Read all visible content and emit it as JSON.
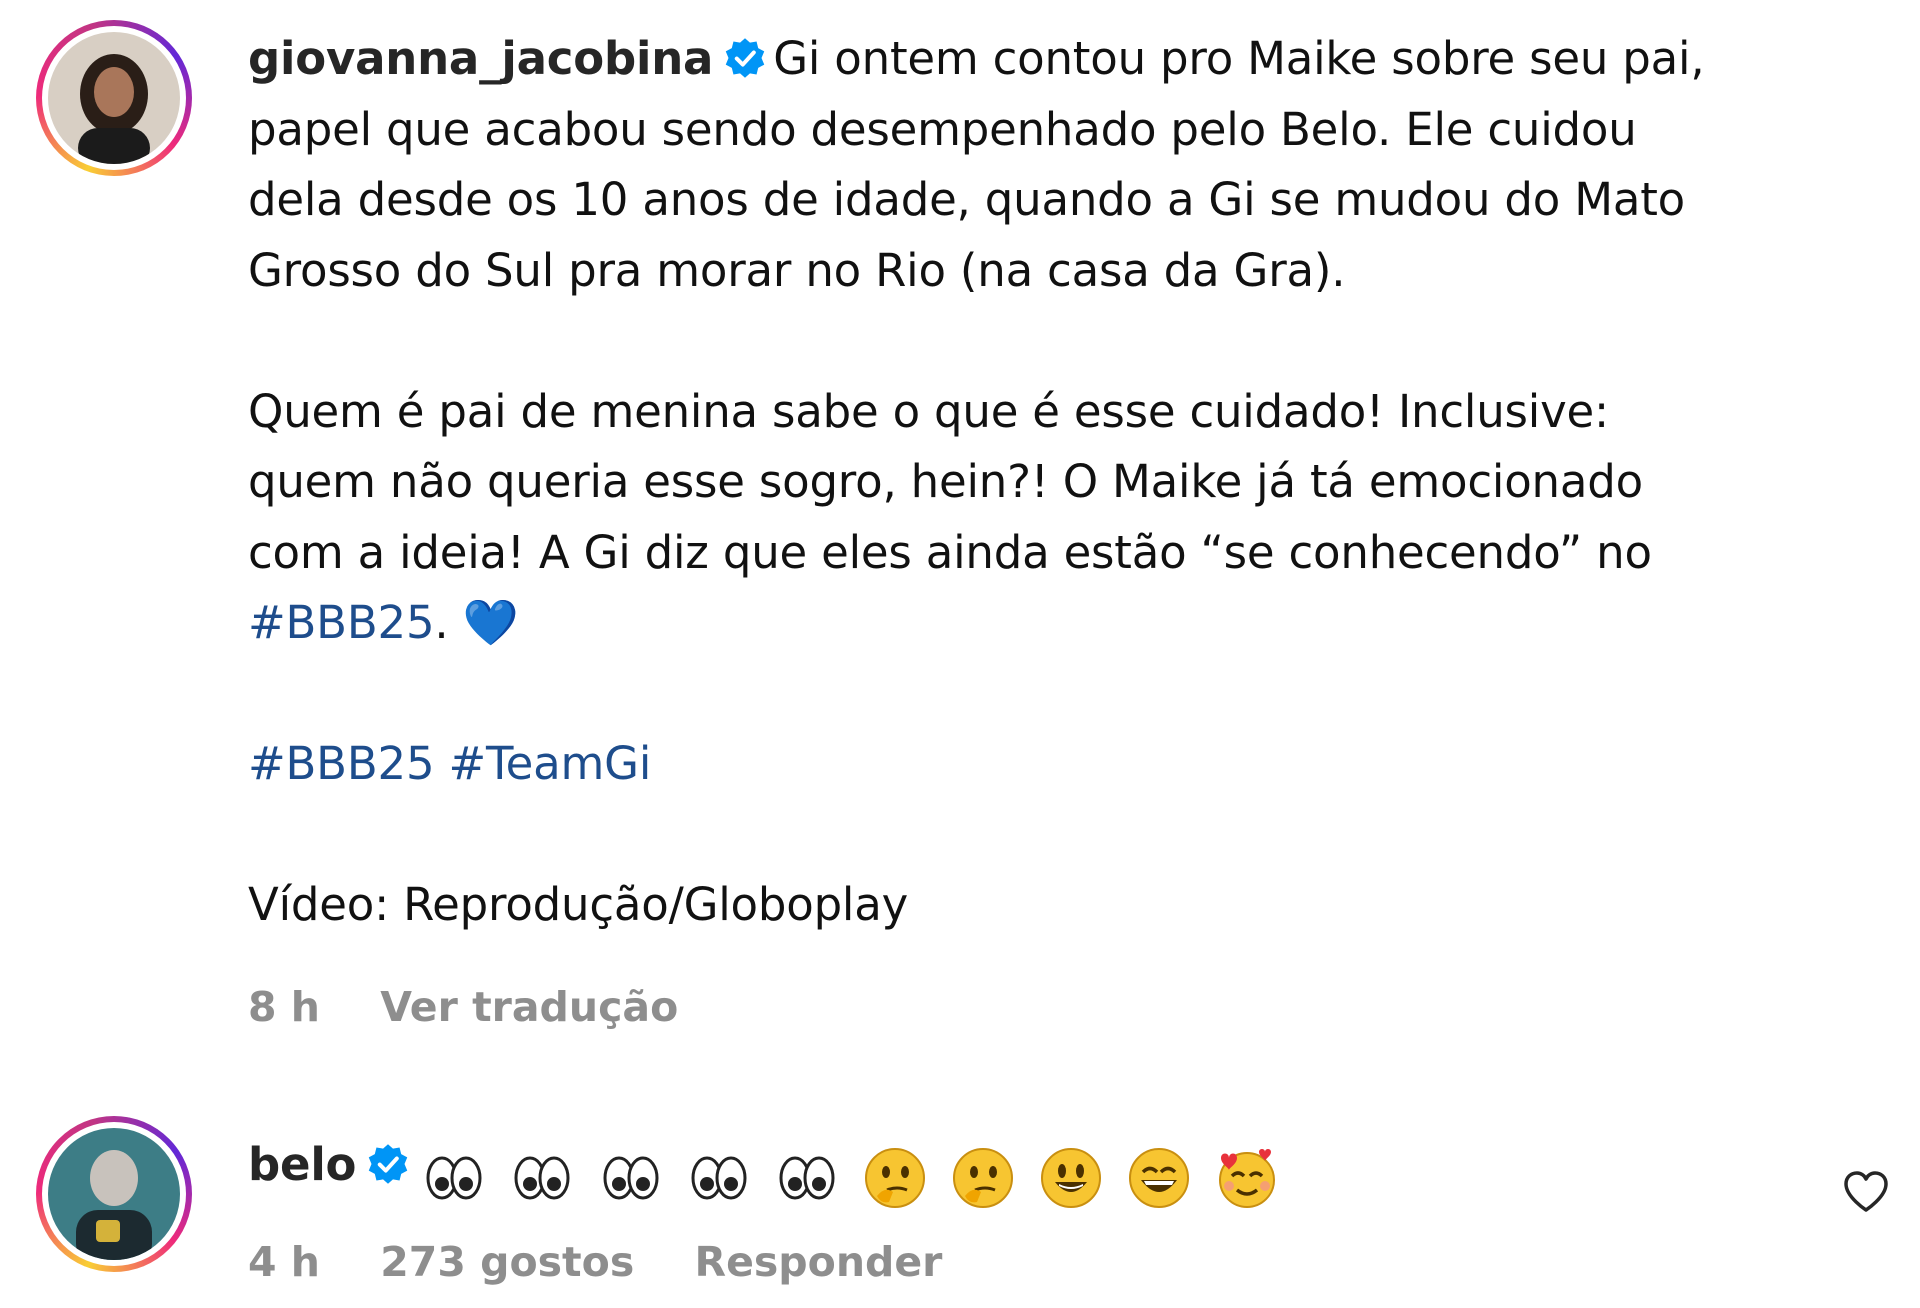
{
  "post": {
    "username": "giovanna_jacobina",
    "verified": true,
    "caption_line1": "Gi ontem contou pro Maike sobre seu pai,",
    "caption_line2": "papel que acabou sendo desempenhado pelo Belo. Ele cuidou",
    "caption_line3": "dela desde os 10 anos de idade, quando a Gi se mudou do Mato",
    "caption_line4": "Grosso do Sul pra morar no Rio (na casa da Gra).",
    "para2_line1": "Quem é pai de menina sabe o que é esse cuidado! Inclusive:",
    "para2_line2": "quem não queria esse sogro, hein?! O Maike já tá emocionado",
    "para2_line3": "com a ideia! A Gi diz que eles ainda estão “se conhecendo” no",
    "para2_hashtag": "#BBB25",
    "para2_end": ". ",
    "heart_emoji": "💙",
    "hashtag1": "#BBB25",
    "hashtag2": "#TeamGi",
    "credit": "Vídeo: Reprodução/Globoplay",
    "time": "8 h",
    "translate": "Ver tradução",
    "accent_color": "#1e4d8c",
    "verified_color": "#0095f6"
  },
  "reply": {
    "username": "belo",
    "verified": true,
    "emojis": [
      "eyes",
      "eyes",
      "eyes",
      "eyes",
      "eyes",
      "thinking",
      "thinking",
      "grinning",
      "smiling-eyes",
      "smiling-hearts"
    ],
    "time": "4 h",
    "likes": "273 gostos",
    "reply_label": "Responder",
    "like_icon": "heart-outline-icon"
  }
}
